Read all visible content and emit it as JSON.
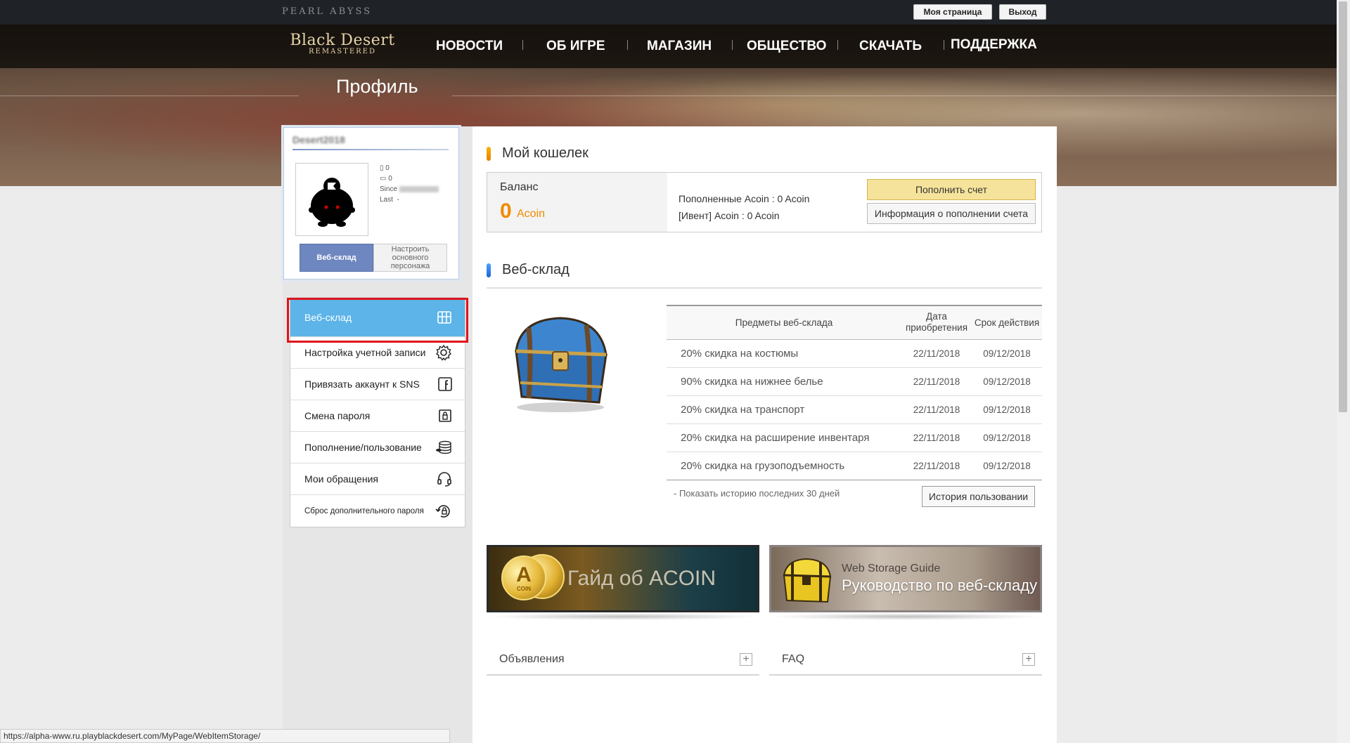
{
  "topbar": {
    "brand": "PEARL ABYSS",
    "my_page": "Моя страница",
    "logout": "Выход"
  },
  "header": {
    "logo_line1": "Black Desert",
    "logo_line2": "REMASTERED",
    "nav": [
      "НОВОСТИ",
      "ОБ ИГРЕ",
      "МАГАЗИН",
      "ОБЩЕСТВО",
      "СКАЧАТЬ",
      "ПОДДЕРЖКА"
    ],
    "page_title": "Профиль"
  },
  "profile": {
    "username": "Desert2018",
    "stat1": "0",
    "stat2": "0",
    "since_label": "Since",
    "last_label": "Last",
    "last_value": "-",
    "web_storage_btn": "Веб-склад",
    "main_char_btn": "Настроить основного персонажа"
  },
  "menu": {
    "items": [
      {
        "label": "Веб-склад",
        "icon": "storage-icon"
      },
      {
        "label": "Настройка учетной записи",
        "icon": "gear-icon"
      },
      {
        "label": "Привязать аккаунт к SNS",
        "icon": "facebook-icon"
      },
      {
        "label": "Смена пароля",
        "icon": "lock-icon"
      },
      {
        "label": "Пополнение/пользование",
        "icon": "coins-icon"
      },
      {
        "label": "Мои обращения",
        "icon": "headset-icon"
      },
      {
        "label": "Сброс дополнительного пароля",
        "icon": "reset-lock-icon"
      }
    ]
  },
  "wallet": {
    "title": "Мой кошелек",
    "balance_label": "Баланс",
    "balance_value": "0",
    "balance_unit": "Acoin",
    "topped_up": "Пополненные Acoin : 0 Acoin",
    "event": "[Ивент] Acoin : 0 Acoin",
    "topup_btn": "Пополнить счет",
    "info_btn": "Информация о пополнении счета",
    "accent": "#f08a00"
  },
  "storage": {
    "title": "Веб-склад",
    "columns": [
      "Предметы веб-склада",
      "Дата приобретения",
      "Срок действия"
    ],
    "rows": [
      [
        "20% скидка на костюмы",
        "22/11/2018",
        "09/12/2018"
      ],
      [
        "90% скидка на нижнее белье",
        "22/11/2018",
        "09/12/2018"
      ],
      [
        "20% скидка на транспорт",
        "22/11/2018",
        "09/12/2018"
      ],
      [
        "20% скидка на расширение инвентаря",
        "22/11/2018",
        "09/12/2018"
      ],
      [
        "20% скидка на грузоподъемность",
        "22/11/2018",
        "09/12/2018"
      ]
    ],
    "history_link": "- Показать историю последних 30 дней",
    "history_btn": "История пользовании"
  },
  "banners": {
    "acoin_title": "Гайд об ACOIN",
    "coin_letter": "A",
    "coin_word": "COIN",
    "guide_en": "Web Storage Guide",
    "guide_ru": "Руководство по веб-складу"
  },
  "bottom": {
    "announcements": "Объявления",
    "faq": "FAQ",
    "plus": "+"
  },
  "status_url": "https://alpha-www.ru.playblackdesert.com/MyPage/WebItemStorage/"
}
